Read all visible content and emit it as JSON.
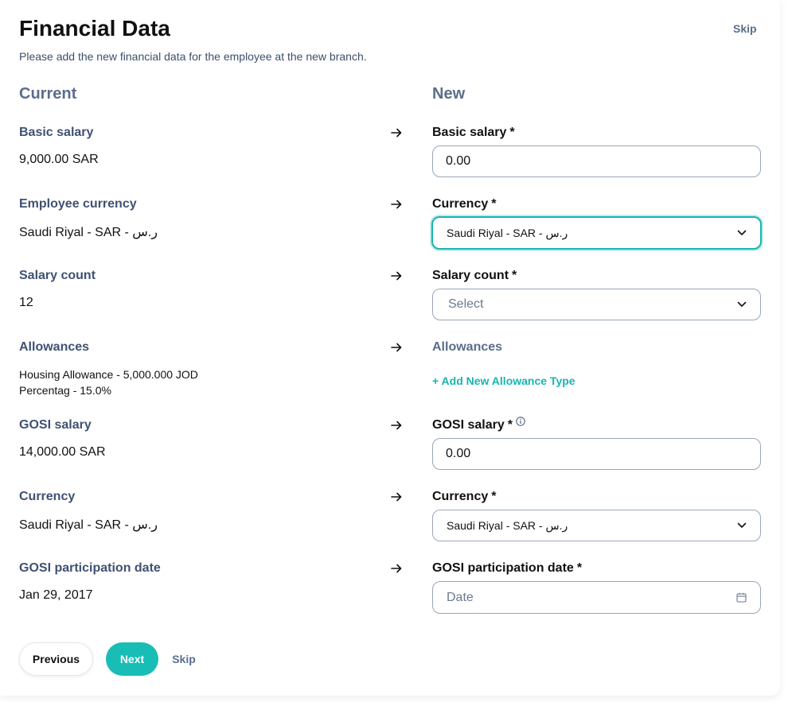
{
  "header": {
    "title": "Financial Data",
    "subtitle": "Please add the new financial data for the employee at the new branch.",
    "skip_label": "Skip"
  },
  "columns": {
    "current_label": "Current",
    "new_label": "New"
  },
  "current": {
    "basic_salary_label": "Basic salary",
    "basic_salary_value": "9,000.00 SAR",
    "employee_currency_label": "Employee currency",
    "employee_currency_value": "Saudi Riyal - SAR - ر.س",
    "salary_count_label": "Salary count",
    "salary_count_value": "12",
    "allowances_label": "Allowances",
    "allowances_lines": [
      "Housing Allowance - 5,000.000 JOD",
      "Percentag - 15.0%"
    ],
    "gosi_salary_label": "GOSI salary",
    "gosi_salary_value": "14,000.00 SAR",
    "currency_label": "Currency",
    "currency_value": "Saudi Riyal - SAR - ر.س",
    "gosi_date_label": "GOSI participation date",
    "gosi_date_value": "Jan 29, 2017"
  },
  "new": {
    "required_marker": "*",
    "basic_salary_label": "Basic salary",
    "basic_salary_value": "0.00",
    "currency_label": "Currency",
    "currency_selected": "Saudi Riyal - SAR - ر.س",
    "salary_count_label": "Salary count",
    "salary_count_placeholder": "Select",
    "allowances_label": "Allowances",
    "add_allowance_label": "+ Add New Allowance Type",
    "gosi_salary_label": "GOSI salary",
    "gosi_salary_value": "0.00",
    "gosi_currency_label": "Currency",
    "gosi_currency_selected": "Saudi Riyal - SAR - ر.س",
    "gosi_date_label": "GOSI participation date",
    "gosi_date_placeholder": "Date"
  },
  "footer": {
    "previous_label": "Previous",
    "next_label": "Next",
    "skip_label": "Skip"
  },
  "colors": {
    "accent": "#18bdb6",
    "label_muted": "#3f5173",
    "heading_muted": "#5a6e8c"
  },
  "icons": {
    "arrow": "arrow-right-icon",
    "chevron": "chevron-down-icon",
    "calendar": "calendar-icon",
    "info": "info-icon"
  }
}
